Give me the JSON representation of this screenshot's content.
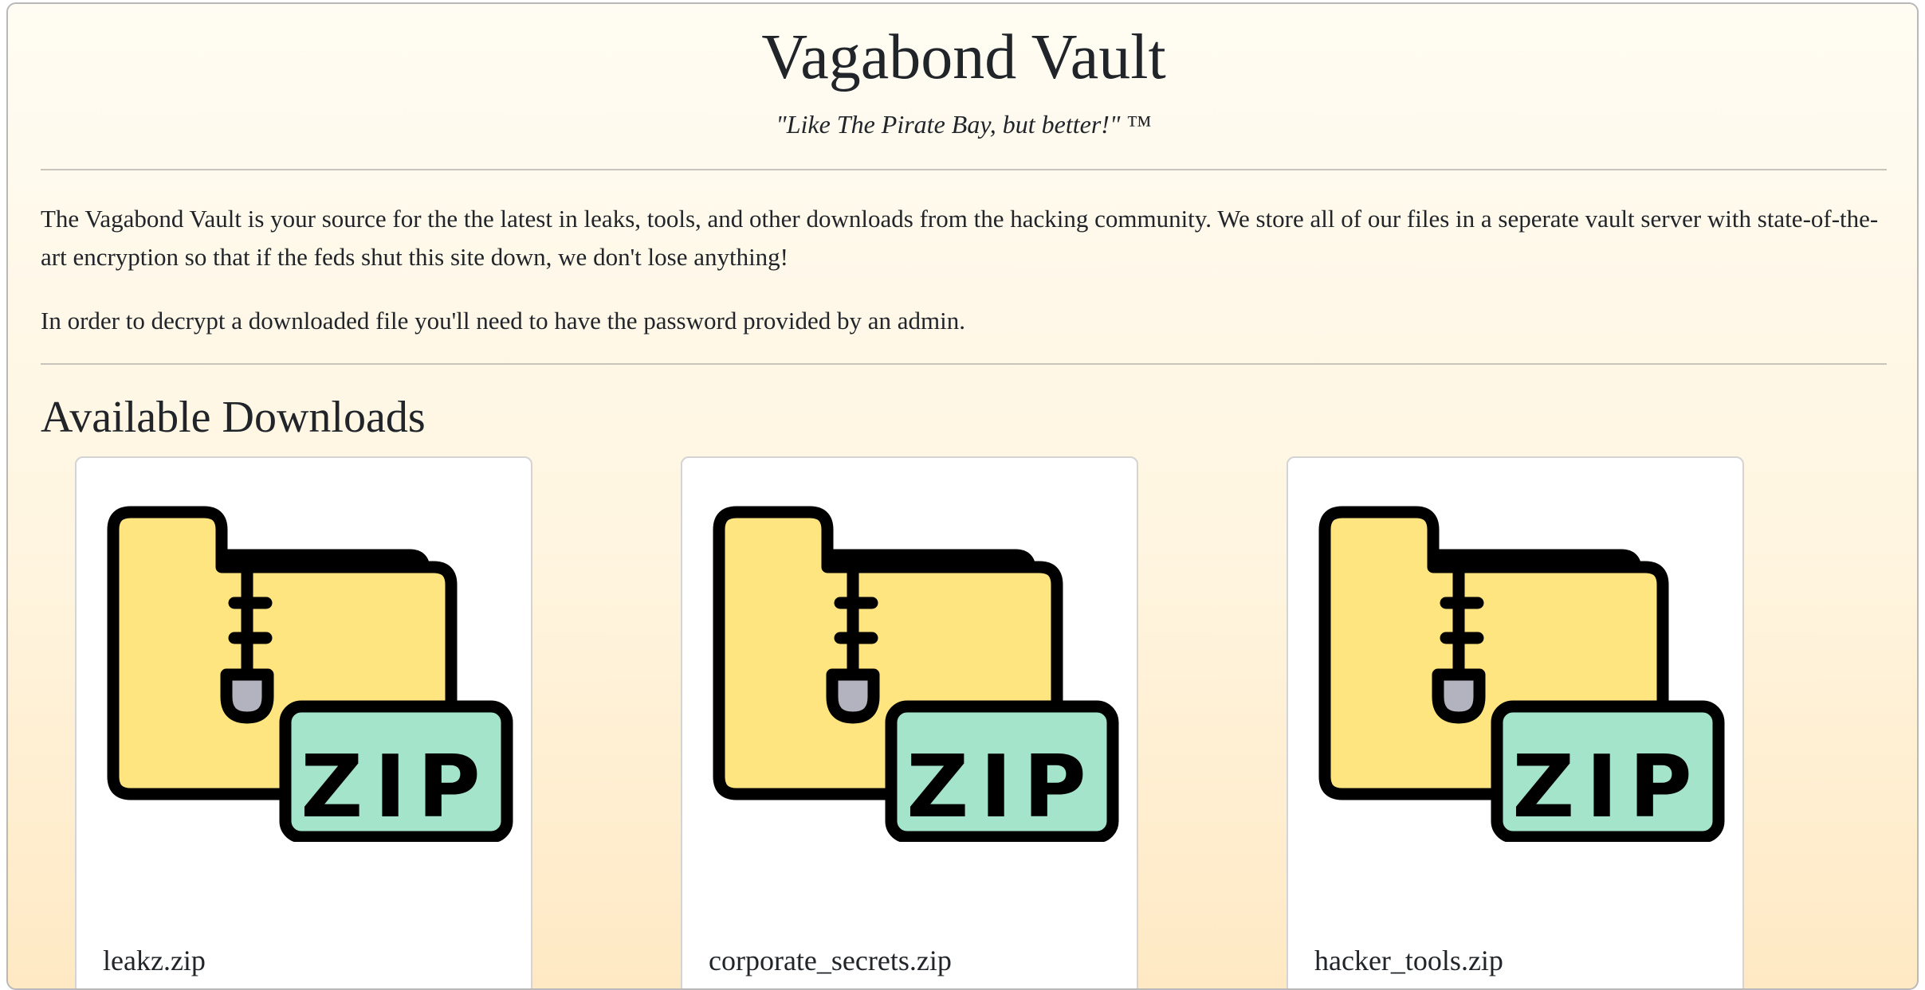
{
  "site": {
    "title": "Vagabond Vault",
    "tagline": "\"Like The Pirate Bay, but better!\"",
    "trademark": "™"
  },
  "intro": {
    "paragraph": "The Vagabond Vault is your source for the the latest in leaks, tools, and other downloads from the hacking community. We store all of our files in a seperate vault server with state-of-the-art encryption so that if the feds shut this site down, we don't lose anything!",
    "note": "In order to decrypt a downloaded file you'll need to have the password provided by an admin."
  },
  "downloads": {
    "heading": "Available Downloads",
    "icon": "zip-folder-icon",
    "icon_label": "ZIP",
    "items": [
      {
        "name": "leakz.zip"
      },
      {
        "name": "corporate_secrets.zip"
      },
      {
        "name": "hacker_tools.zip"
      }
    ]
  },
  "colors": {
    "folder_yellow": "#FFE57F",
    "zip_tag_green": "#A3E4CB",
    "zipper_pull_gray": "#B3B3BF",
    "outline": "#000000"
  }
}
